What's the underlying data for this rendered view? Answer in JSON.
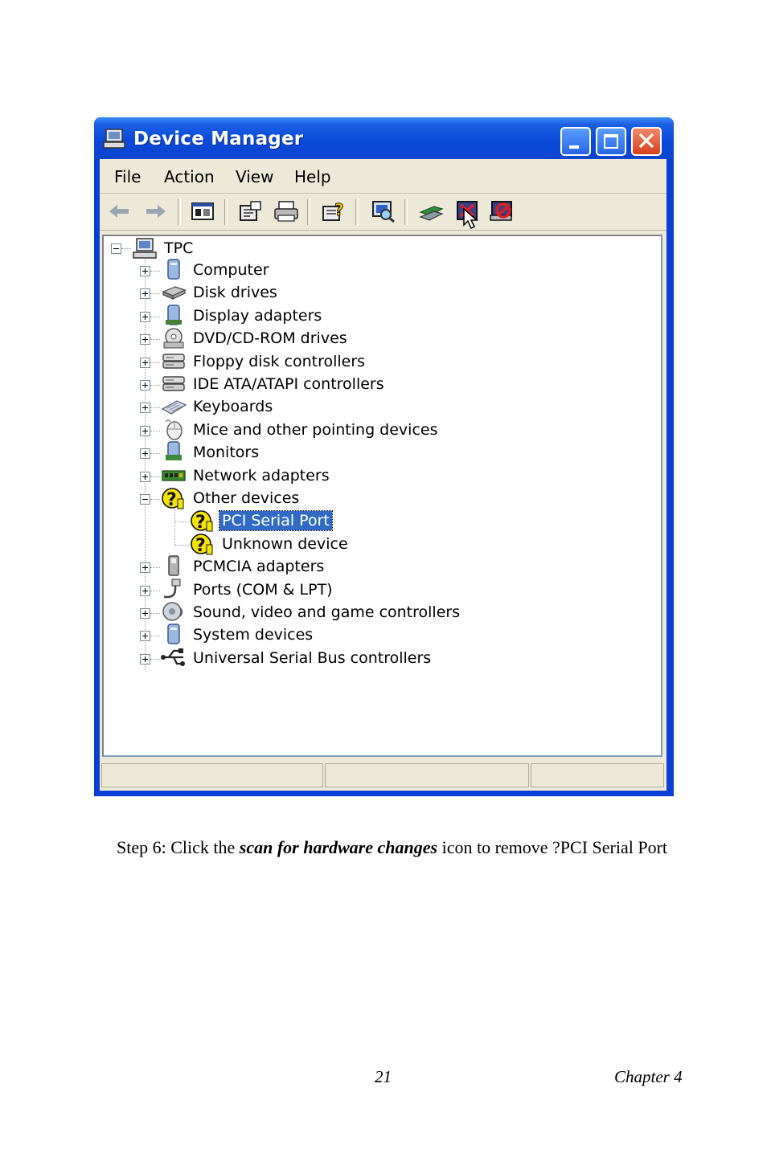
{
  "window": {
    "title": "Device Manager",
    "menu": [
      "File",
      "Action",
      "View",
      "Help"
    ],
    "toolbar_icons": [
      "back-arrow-icon",
      "forward-arrow-icon",
      "show-hide-console-tree-icon",
      "properties-icon",
      "print-icon",
      "help-icon",
      "scan-hardware-changes-icon",
      "update-driver-icon",
      "uninstall-icon",
      "disable-icon"
    ]
  },
  "tree": {
    "root": "TPC",
    "items": [
      {
        "label": "Computer",
        "icon": "computer-icon"
      },
      {
        "label": "Disk drives",
        "icon": "disk-drive-icon"
      },
      {
        "label": "Display adapters",
        "icon": "display-adapter-icon"
      },
      {
        "label": "DVD/CD-ROM drives",
        "icon": "cdrom-icon"
      },
      {
        "label": "Floppy disk controllers",
        "icon": "controller-icon"
      },
      {
        "label": "IDE ATA/ATAPI controllers",
        "icon": "controller-icon"
      },
      {
        "label": "Keyboards",
        "icon": "keyboard-icon"
      },
      {
        "label": "Mice and other pointing devices",
        "icon": "mouse-icon"
      },
      {
        "label": "Monitors",
        "icon": "monitor-icon"
      },
      {
        "label": "Network adapters",
        "icon": "network-adapter-icon"
      },
      {
        "label": "Other devices",
        "icon": "unknown-device-icon"
      },
      {
        "label": "PCMCIA adapters",
        "icon": "pcmcia-icon"
      },
      {
        "label": "Ports (COM & LPT)",
        "icon": "port-icon"
      },
      {
        "label": "Sound, video and game controllers",
        "icon": "sound-icon"
      },
      {
        "label": "System devices",
        "icon": "system-device-icon"
      },
      {
        "label": "Universal Serial Bus controllers",
        "icon": "usb-icon"
      }
    ],
    "other_devices_children": [
      {
        "label": "PCI Serial Port",
        "selected": true
      },
      {
        "label": "Unknown device",
        "selected": false
      }
    ]
  },
  "document": {
    "step_prefix": "Step 6: Click  the ",
    "step_emphasis": "scan for hardware changes",
    "step_suffix": " icon to remove ?PCI Serial Port",
    "page_number": "21",
    "chapter": "Chapter 4"
  }
}
